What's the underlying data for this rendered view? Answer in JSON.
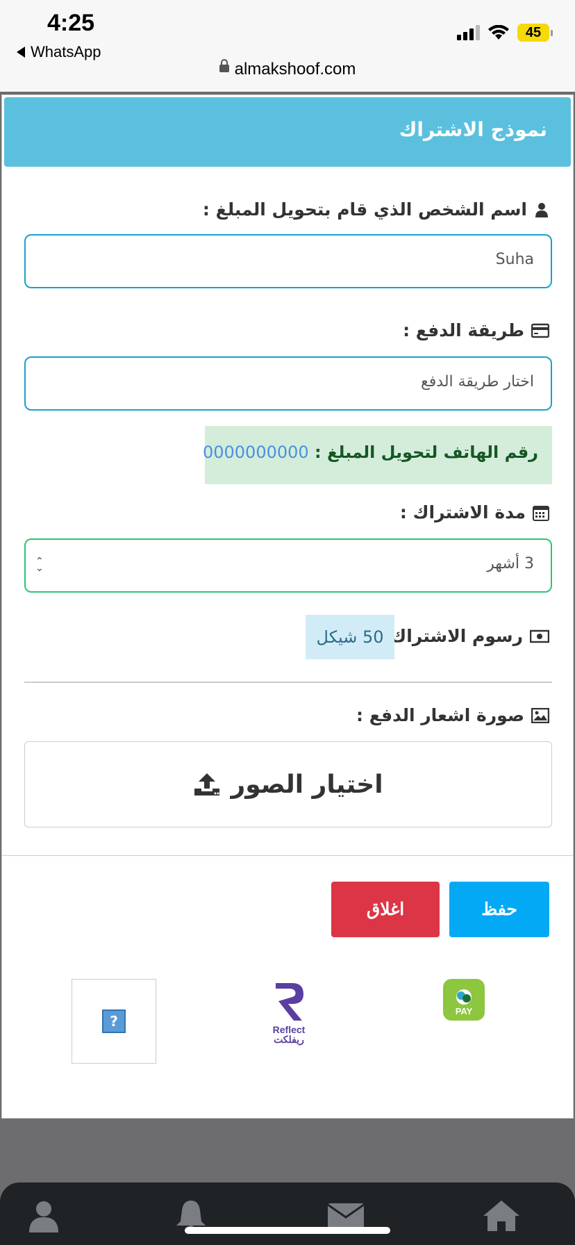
{
  "status_bar": {
    "time": "4:25",
    "back_app": "WhatsApp",
    "battery": "45",
    "url": "almakshoof.com"
  },
  "modal": {
    "title": "نموذج الاشتراك",
    "name_label": "اسم الشخص الذي قام بتحويل المبلغ :",
    "name_value": "Suha",
    "payment_label": "طريقة الدفع :",
    "payment_value": "اختار طريقة الدفع",
    "phone_label": "رقم الهاتف لتحويل المبلغ :",
    "phone_number": "0000000000",
    "duration_label": "مدة الاشتراك :",
    "duration_value": "3 أشهر",
    "fee_label": "رسوم الاشتراك :",
    "fee_value": "50 شيكل",
    "receipt_label": "صورة اشعار الدفع :",
    "upload_label": "اختيار الصور",
    "save_label": "حفظ",
    "close_label": "اغلاق"
  },
  "logos": {
    "reflect_en": "Reflect",
    "reflect_ar": "ريفلكت",
    "pay": "PAY",
    "placeholder": "?"
  },
  "colors": {
    "header": "#5bc0de",
    "save": "#03a9f4",
    "close": "#dc3545",
    "phone_bg": "#d4edda"
  },
  "icons": [
    "user-icon",
    "bell-icon",
    "mail-icon",
    "home-icon"
  ]
}
